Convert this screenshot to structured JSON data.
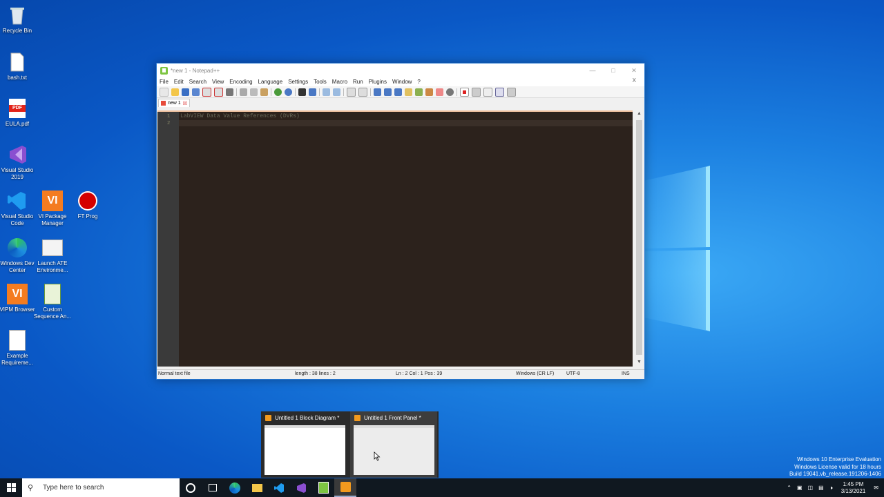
{
  "desktop": {
    "icons": [
      {
        "label": "Recycle Bin"
      },
      {
        "label": "bash.txt"
      },
      {
        "label": "EULA.pdf"
      },
      {
        "label": "Visual Studio 2019"
      },
      {
        "label": "Visual Studio Code"
      },
      {
        "label": "VI Package Manager"
      },
      {
        "label": "FT Prog"
      },
      {
        "label": "Windows Dev Center"
      },
      {
        "label": "Launch ATE Environme..."
      },
      {
        "label": "VIPM Browser"
      },
      {
        "label": "Custom Sequence An..."
      },
      {
        "label": "Example Requireme..."
      }
    ],
    "pdf_badge": "PDF",
    "vi_badge": "VI"
  },
  "notepad": {
    "title": "*new 1 - Notepad++",
    "menu": [
      "File",
      "Edit",
      "Search",
      "View",
      "Encoding",
      "Language",
      "Settings",
      "Tools",
      "Macro",
      "Run",
      "Plugins",
      "Window",
      "?"
    ],
    "close_doc": "X",
    "tab_label": "new 1",
    "line_numbers": [
      "1",
      "2"
    ],
    "code_line_1": "LabVIEW Data Value References (DVRs)",
    "status": {
      "type": "Normal text file",
      "length": "length : 38    lines : 2",
      "position": "Ln : 2    Col : 1    Pos : 39",
      "eol": "Windows (CR LF)",
      "encoding": "UTF-8",
      "mode": "INS"
    }
  },
  "thumbnails": [
    {
      "title": "Untitled 1 Block Diagram *"
    },
    {
      "title": "Untitled 1 Front Panel *"
    }
  ],
  "watermark": {
    "line1": "Windows 10 Enterprise Evaluation",
    "line2": "Windows License valid for 18 hours",
    "line3": "Build 19041.vb_release.191206-1406"
  },
  "taskbar": {
    "search_placeholder": "Type here to search",
    "time": "1:45 PM",
    "date": "3/13/2021"
  }
}
